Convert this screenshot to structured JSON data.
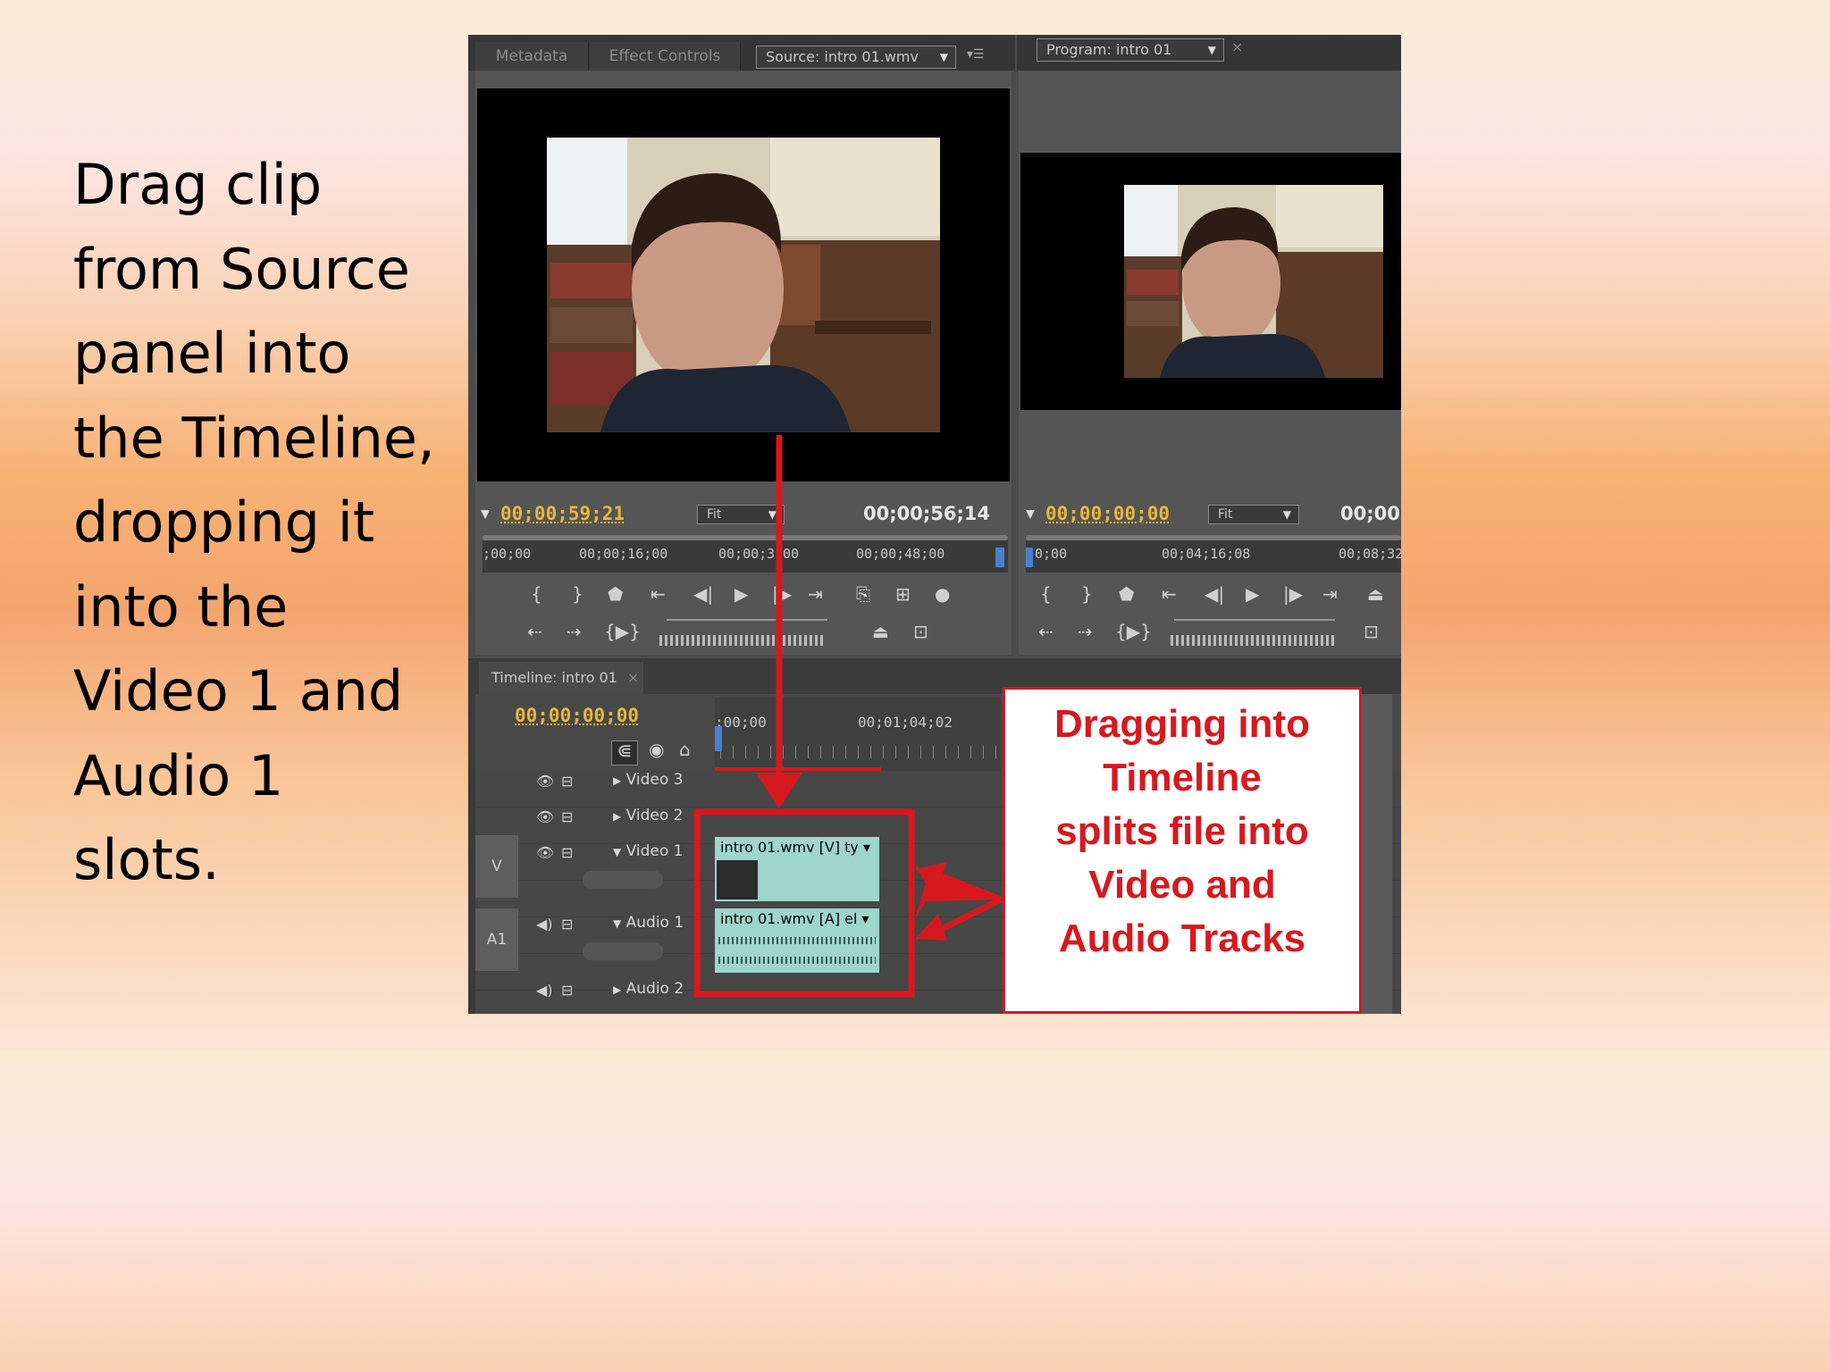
{
  "caption": {
    "lines": [
      "Drag clip",
      "from Source",
      "panel into",
      "the Timeline,",
      "dropping it",
      "into the",
      "Video 1 and",
      "Audio 1",
      "slots."
    ]
  },
  "source_panel": {
    "tabs": [
      "Metadata",
      "Effect Controls"
    ],
    "source_dropdown": "Source: intro 01.wmv",
    "current_timecode": "00;00;59;21",
    "zoom": "Fit",
    "duration_timecode": "00;00;56;14",
    "ruler_labels": [
      ";00;00",
      "00;00;16;00",
      "00;00;3",
      "00",
      "00;00;48;00"
    ]
  },
  "program_panel": {
    "program_dropdown": "Program: intro 01",
    "current_timecode": "00;00;00;00",
    "zoom": "Fit",
    "duration_timecode": "00;00;",
    "ruler_labels": [
      "0;00",
      "00;04;16;08",
      "00;08;32"
    ]
  },
  "timeline": {
    "tab_label": "Timeline: intro 01",
    "current_timecode": "00;00;00;00",
    "ruler_labels": [
      ";00;00",
      "00;01;04;02"
    ],
    "tracks": {
      "video3": "Video 3",
      "video2": "Video 2",
      "video1": "Video 1",
      "audio1": "Audio 1",
      "audio2": "Audio 2",
      "v_target": "V",
      "a_target": "A1"
    },
    "clips": {
      "video_clip": "intro 01.wmv [V]",
      "video_fx": "ty",
      "audio_clip": "intro 01.wmv [A]",
      "audio_fx": "el"
    }
  },
  "callout": {
    "lines": [
      "Dragging into",
      "Timeline",
      "splits file into",
      "Video and",
      "Audio Tracks"
    ],
    "color": "#d6191f"
  },
  "colors": {
    "accent_red": "#d6191f",
    "timecode_yellow": "#e7b83a",
    "clip_teal": "#9ed6cb"
  }
}
